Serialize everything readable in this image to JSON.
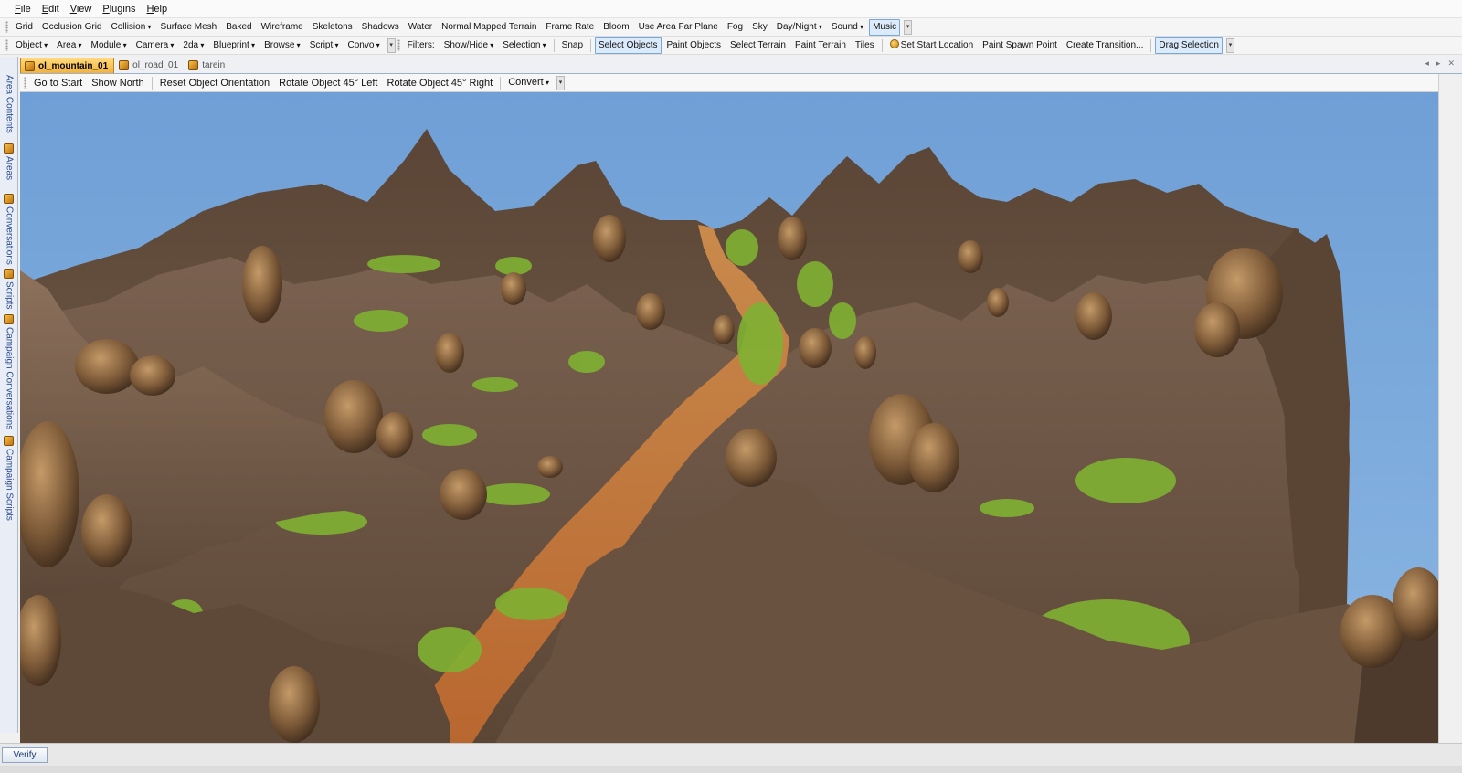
{
  "menu": [
    "File",
    "Edit",
    "View",
    "Plugins",
    "Help"
  ],
  "toolbar1": {
    "items": [
      {
        "label": "Grid",
        "dd": false,
        "active": false
      },
      {
        "label": "Occlusion Grid",
        "dd": false,
        "active": false
      },
      {
        "label": "Collision",
        "dd": true,
        "active": false
      },
      {
        "label": "Surface Mesh",
        "dd": false,
        "active": false
      },
      {
        "label": "Baked",
        "dd": false,
        "active": false
      },
      {
        "label": "Wireframe",
        "dd": false,
        "active": false
      },
      {
        "label": "Skeletons",
        "dd": false,
        "active": false
      },
      {
        "label": "Shadows",
        "dd": false,
        "active": false
      },
      {
        "label": "Water",
        "dd": false,
        "active": false
      },
      {
        "label": "Normal Mapped Terrain",
        "dd": false,
        "active": false
      },
      {
        "label": "Frame Rate",
        "dd": false,
        "active": false
      },
      {
        "label": "Bloom",
        "dd": false,
        "active": false
      },
      {
        "label": "Use Area Far Plane",
        "dd": false,
        "active": false
      },
      {
        "label": "Fog",
        "dd": false,
        "active": false
      },
      {
        "label": "Sky",
        "dd": false,
        "active": false
      },
      {
        "label": "Day/Night",
        "dd": true,
        "active": false
      },
      {
        "label": "Sound",
        "dd": true,
        "active": false
      },
      {
        "label": "Music",
        "dd": false,
        "active": true
      }
    ]
  },
  "toolbar2": {
    "group1": [
      {
        "label": "Object",
        "dd": true
      },
      {
        "label": "Area",
        "dd": true
      },
      {
        "label": "Module",
        "dd": true
      },
      {
        "label": "Camera",
        "dd": true
      },
      {
        "label": "2da",
        "dd": true
      },
      {
        "label": "Blueprint",
        "dd": true
      },
      {
        "label": "Browse",
        "dd": true
      },
      {
        "label": "Script",
        "dd": true
      },
      {
        "label": "Convo",
        "dd": true
      }
    ],
    "group2": [
      {
        "label": "Filters:",
        "dd": false,
        "active": false
      },
      {
        "label": "Show/Hide",
        "dd": true,
        "active": false
      },
      {
        "label": "Selection",
        "dd": true,
        "active": false
      },
      {
        "label": "SEP",
        "dd": false,
        "active": false
      },
      {
        "label": "Snap",
        "dd": false,
        "active": false
      },
      {
        "label": "SEP",
        "dd": false,
        "active": false
      },
      {
        "label": "Select Objects",
        "dd": false,
        "active": true
      },
      {
        "label": "Paint Objects",
        "dd": false,
        "active": false
      },
      {
        "label": "Select Terrain",
        "dd": false,
        "active": false
      },
      {
        "label": "Paint Terrain",
        "dd": false,
        "active": false
      },
      {
        "label": "Tiles",
        "dd": false,
        "active": false
      },
      {
        "label": "SEP",
        "dd": false,
        "active": false
      },
      {
        "label": "Set Start Location",
        "dd": false,
        "active": false,
        "icon": "start-location-icon"
      },
      {
        "label": "Paint Spawn Point",
        "dd": false,
        "active": false
      },
      {
        "label": "Create Transition...",
        "dd": false,
        "active": false
      },
      {
        "label": "SEP",
        "dd": false,
        "active": false
      },
      {
        "label": "Drag Selection",
        "dd": false,
        "active": true
      }
    ]
  },
  "side_tabs": [
    {
      "label": "Area Contents",
      "icon": false
    },
    {
      "label": "Areas",
      "icon": true
    },
    {
      "label": "Conversations",
      "icon": true
    },
    {
      "label": "Scripts",
      "icon": true
    },
    {
      "label": "Campaign Conversations",
      "icon": true
    },
    {
      "label": "Campaign Scripts",
      "icon": true
    }
  ],
  "doc_tabs": [
    {
      "label": "ol_mountain_01",
      "active": true
    },
    {
      "label": "ol_road_01",
      "active": false
    },
    {
      "label": "tarein",
      "active": false
    }
  ],
  "tab_controls": [
    "◂",
    "▸",
    "✕"
  ],
  "view_toolbar": [
    {
      "label": "Go to Start",
      "dd": false
    },
    {
      "label": "Show North",
      "dd": false
    },
    {
      "label": "SEP",
      "dd": false
    },
    {
      "label": "Reset Object Orientation",
      "dd": false
    },
    {
      "label": "Rotate Object 45° Left",
      "dd": false
    },
    {
      "label": "Rotate Object 45° Right",
      "dd": false
    },
    {
      "label": "SEP",
      "dd": false
    },
    {
      "label": "Convert",
      "dd": true
    }
  ],
  "status": {
    "verify_label": "Verify"
  },
  "colors": {
    "sky": "#78a8da",
    "terrain_dark": "#4d3a2c",
    "terrain_mid": "#6b5240",
    "terrain_light": "#8a705a",
    "grass": "#7fb132",
    "road": "#c27a3e",
    "rock": "#8b6843",
    "accent_active": "#dcebfb",
    "tab_active": "#f2b23c"
  }
}
